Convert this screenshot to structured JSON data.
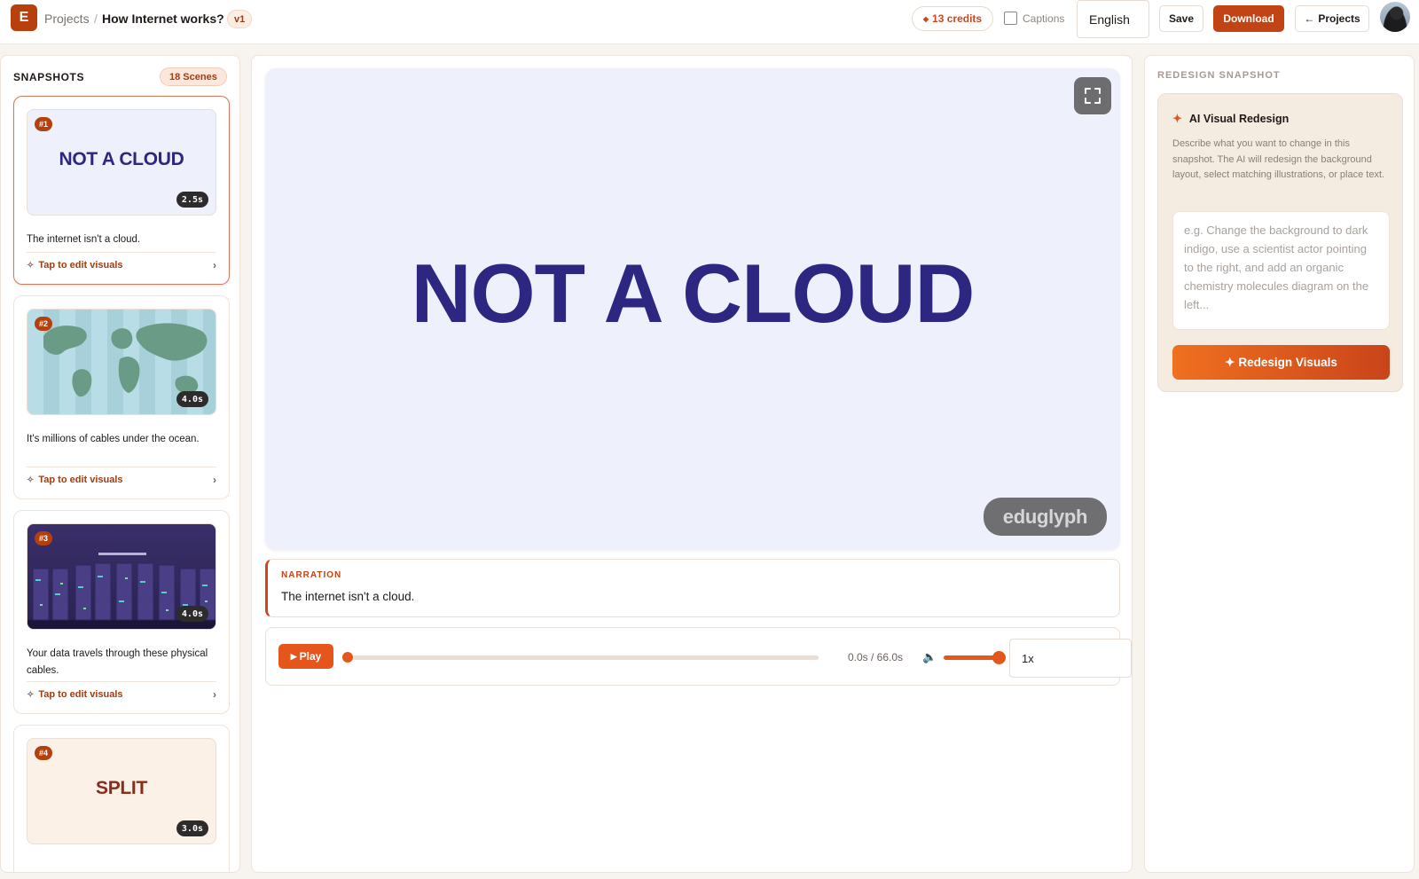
{
  "header": {
    "logo_letter": "E",
    "breadcrumb_root": "Projects",
    "separator": "/",
    "project_title": "How Internet works?",
    "version": "v1",
    "credits": "13 credits",
    "credits_icon": "◆",
    "captions_label": "Captions",
    "captions_checked": false,
    "language": "English",
    "save_label": "Save",
    "download_label": "Download",
    "projects_back_label": "Projects",
    "projects_back_icon": "←"
  },
  "sidebar": {
    "title": "SNAPSHOTS",
    "scene_count": "18 Scenes",
    "edit_label": "Tap to edit visuals",
    "scenes": [
      {
        "number": "#1",
        "duration": "2.5s",
        "thumb_text": "NOT A CLOUD",
        "caption": "The internet isn't a cloud.",
        "active": true
      },
      {
        "number": "#2",
        "duration": "4.0s",
        "thumb_text": "",
        "caption": "It's millions of cables under the ocean.",
        "active": false
      },
      {
        "number": "#3",
        "duration": "4.0s",
        "thumb_text": "",
        "caption": "Your data travels through these physical cables.",
        "active": false
      },
      {
        "number": "#4",
        "duration": "3.0s",
        "thumb_text": "SPLIT",
        "caption": "",
        "active": false
      }
    ]
  },
  "stage": {
    "title": "NOT A CLOUD",
    "watermark": "eduglyph",
    "background": "#eef0fc",
    "title_color": "#2e2782"
  },
  "narration": {
    "label": "NARRATION",
    "text": "The internet isn't a cloud."
  },
  "player": {
    "play_label": "Play",
    "play_icon": "▶",
    "time": "0.0s / 66.0s",
    "progress": 0.0,
    "volume": 1.0,
    "speed": "1x"
  },
  "redesign": {
    "title": "REDESIGN SNAPSHOT",
    "heading": "AI Visual Redesign",
    "star_icon": "✦",
    "description": "Describe what you want to change in this snapshot. The AI will redesign the background layout, select matching illustrations, or place text.",
    "placeholder": "e.g. Change the background to dark indigo, use a scientist actor pointing to the right, and add an organic chemistry molecules diagram on the left...",
    "button_label": "Redesign Visuals",
    "button_icon": "✦"
  },
  "colors": {
    "accent": "#c24414",
    "accent_bright": "#e5561c"
  }
}
